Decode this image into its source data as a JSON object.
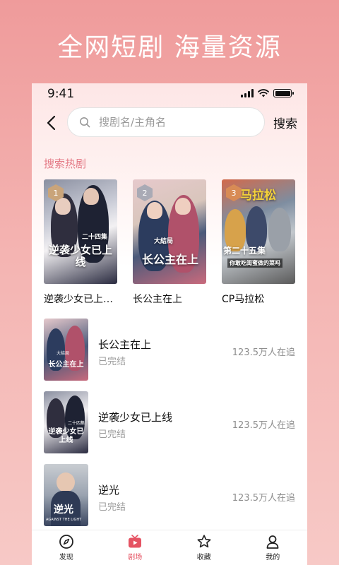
{
  "headline": "全网短剧  海量资源",
  "status_bar": {
    "time": "9:41"
  },
  "search": {
    "placeholder": "搜剧名/主角名",
    "button_label": "搜索"
  },
  "hot_section": {
    "title": "搜索热剧",
    "items": [
      {
        "rank": "1",
        "title": "逆袭少女已上…",
        "poster_text": "逆袭少女已上线",
        "poster_badge": "二十四集",
        "rank_color": "#c9a47a"
      },
      {
        "rank": "2",
        "title": "长公主在上",
        "poster_text": "长公主在上",
        "poster_badge": "大結局",
        "rank_color": "#a9aab5"
      },
      {
        "rank": "3",
        "title": "CP马拉松",
        "poster_text": "第二十五集",
        "poster_badge": "马拉松",
        "poster_sub": "你敢吃闺蜜做的菜吗",
        "rank_color": "#d88b55"
      }
    ]
  },
  "list": [
    {
      "title": "长公主在上",
      "status": "已完结",
      "count": "123.5万人在追",
      "thumb_text": "长公主在上",
      "thumb_badge": "大結局"
    },
    {
      "title": "逆袭少女已上线",
      "status": "已完结",
      "count": "123.5万人在追",
      "thumb_text": "逆袭少女已上线",
      "thumb_badge": "二十四集"
    },
    {
      "title": "逆光",
      "status": "已完结",
      "count": "123.5万人在追",
      "thumb_text": "逆光",
      "thumb_badge": "AGAINST THE LIGHT"
    }
  ],
  "tabs": [
    {
      "label": "发现",
      "icon": "compass-icon",
      "active": false
    },
    {
      "label": "剧场",
      "icon": "tv-play-icon",
      "active": true
    },
    {
      "label": "收藏",
      "icon": "star-icon",
      "active": false
    },
    {
      "label": "我的",
      "icon": "user-icon",
      "active": false
    }
  ],
  "colors": {
    "accent": "#e55363",
    "section_title": "#e47a86"
  }
}
